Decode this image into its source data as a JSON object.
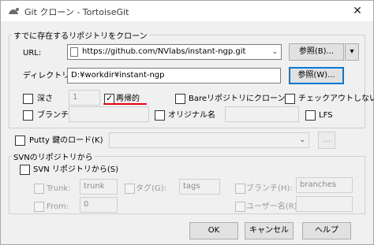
{
  "window": {
    "title": "Git クローン - TortoiseGit",
    "close_glyph": "✕"
  },
  "clone_group": {
    "legend": "すでに存在するリポジトリをクローン",
    "url_label": "URL:",
    "url_value": "https://github.com/NVlabs/instant-ngp.git",
    "browse_url_label": "参照(B)...",
    "browse_split_glyph": "▾",
    "dir_label": "ディレクトリ",
    "dir_value": "D:¥workdir¥instant-ngp",
    "browse_dir_label": "参照(W)...",
    "depth_label": "深さ",
    "depth_value": "1",
    "recursive_label": "再帰的",
    "recursive_checked": true,
    "bare_label": "Bareリポジトリにクローン",
    "no_checkout_label": "チェックアウトしない",
    "branch_label": "ブランチ",
    "origin_label": "オリジナル名",
    "lfs_label": "LFS"
  },
  "putty": {
    "label": "Putty 鍵のロード(K)",
    "browse_label": "..."
  },
  "svn_group": {
    "legend": "SVNのリポジトリから",
    "from_svn_label": "SVN リポジトリから(S)",
    "trunk_label": "Trunk:",
    "trunk_value": "trunk",
    "tags_label": "タグ(G):",
    "tags_value": "tags",
    "branches_label": "ブランチ(H):",
    "branches_value": "branches",
    "from_label": "From:",
    "from_value": "0",
    "username_label": "ユーザー名(R):"
  },
  "footer": {
    "ok_label": "OK",
    "cancel_label": "キャンセル",
    "help_label": "ヘルプ"
  },
  "colors": {
    "accent": "#0078d7",
    "annotation": "#e60012"
  }
}
